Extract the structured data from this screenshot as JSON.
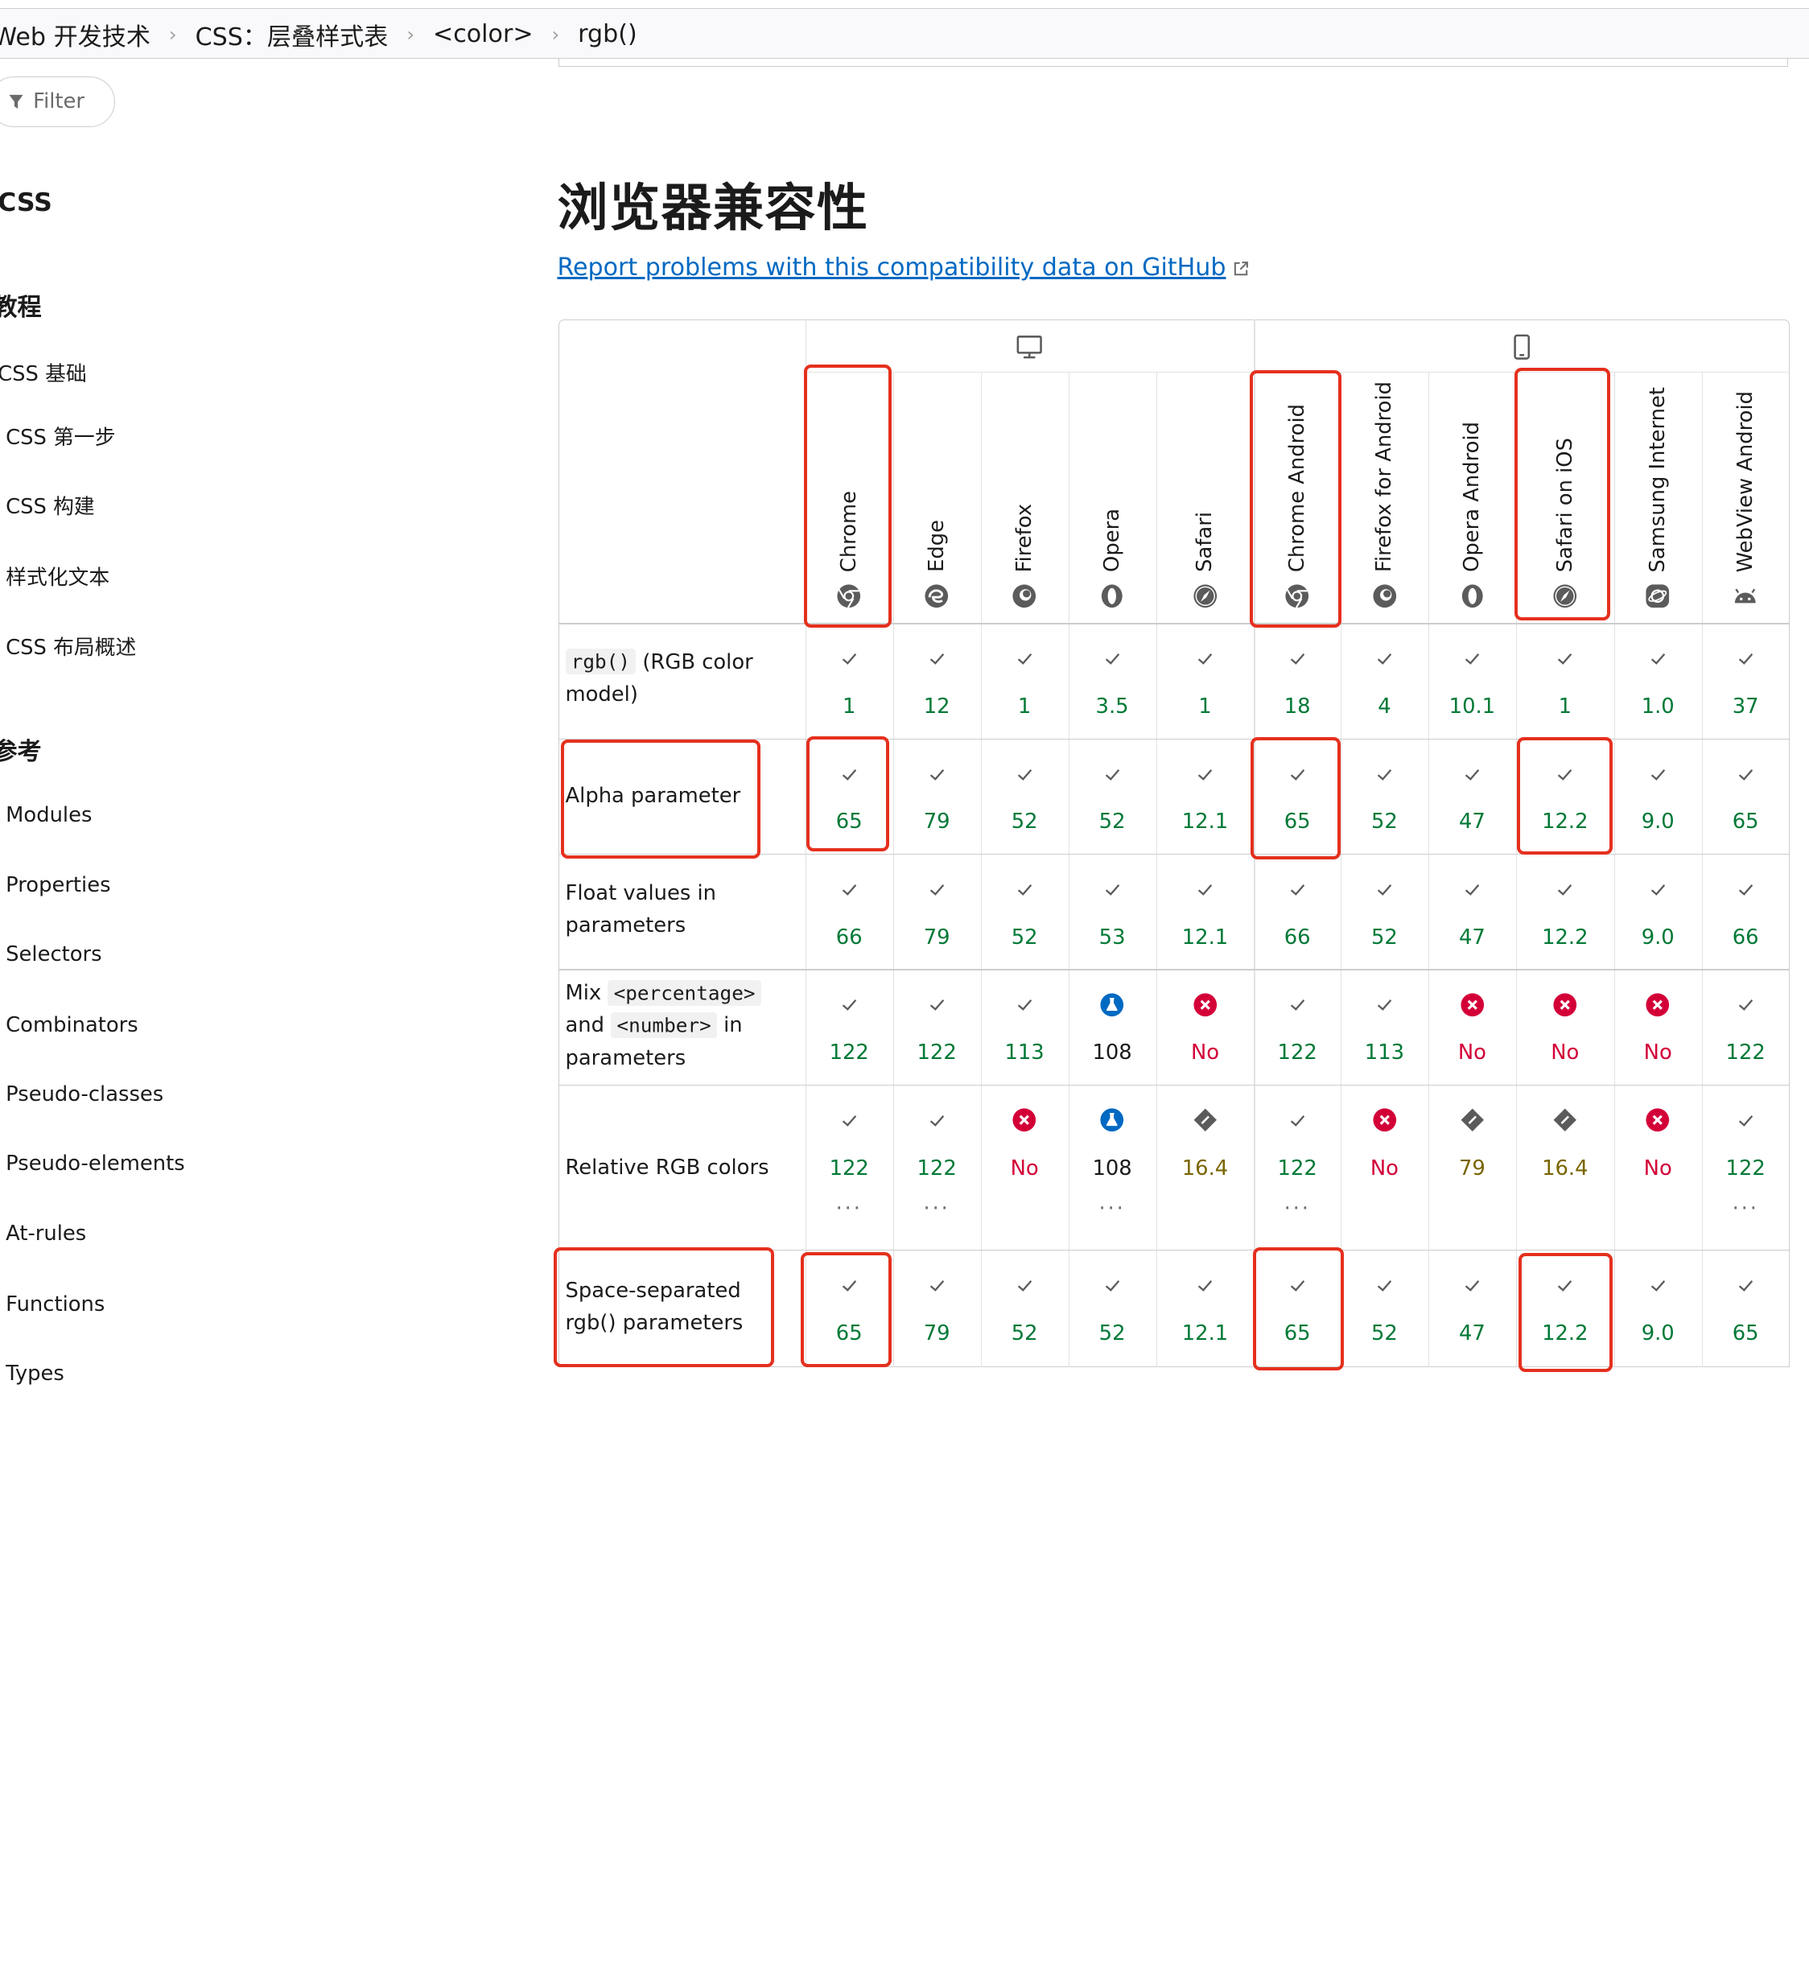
{
  "breadcrumb": [
    "Web 开发技术",
    "CSS：层叠样式表",
    "<color>",
    "rgb()"
  ],
  "sidebar": {
    "filter_placeholder": "Filter",
    "title": "CSS",
    "tutorials_heading": "教程",
    "tutorials": [
      "CSS 基础",
      "CSS 第一步",
      "CSS 构建",
      "样式化文本",
      "CSS 布局概述"
    ],
    "reference_heading": "参考",
    "reference": [
      "Modules",
      "Properties",
      "Selectors",
      "Combinators",
      "Pseudo-classes",
      "Pseudo-elements",
      "At-rules",
      "Functions",
      "Types"
    ]
  },
  "section_title": "浏览器兼容性",
  "report_link": "Report problems with this compatibility data on GitHub",
  "platforms": [
    {
      "name": "desktop",
      "icon": "desktop-icon"
    },
    {
      "name": "mobile",
      "icon": "mobile-icon"
    }
  ],
  "browsers": [
    {
      "name": "Chrome",
      "icon": "chrome-icon",
      "platform": "desktop"
    },
    {
      "name": "Edge",
      "icon": "edge-icon",
      "platform": "desktop"
    },
    {
      "name": "Firefox",
      "icon": "firefox-icon",
      "platform": "desktop"
    },
    {
      "name": "Opera",
      "icon": "opera-icon",
      "platform": "desktop"
    },
    {
      "name": "Safari",
      "icon": "safari-icon",
      "platform": "desktop"
    },
    {
      "name": "Chrome Android",
      "icon": "chrome-icon",
      "platform": "mobile"
    },
    {
      "name": "Firefox for Android",
      "icon": "firefox-icon",
      "platform": "mobile"
    },
    {
      "name": "Opera Android",
      "icon": "opera-icon",
      "platform": "mobile"
    },
    {
      "name": "Safari on iOS",
      "icon": "safari-icon",
      "platform": "mobile"
    },
    {
      "name": "Samsung Internet",
      "icon": "samsung-internet-icon",
      "platform": "mobile"
    },
    {
      "name": "WebView Android",
      "icon": "android-icon",
      "platform": "mobile"
    }
  ],
  "features": [
    {
      "code": "rgb()",
      "label": "(RGB color model)",
      "support": [
        {
          "s": "yes",
          "v": "1"
        },
        {
          "s": "yes",
          "v": "12"
        },
        {
          "s": "yes",
          "v": "1"
        },
        {
          "s": "yes",
          "v": "3.5"
        },
        {
          "s": "yes",
          "v": "1"
        },
        {
          "s": "yes",
          "v": "18"
        },
        {
          "s": "yes",
          "v": "4"
        },
        {
          "s": "yes",
          "v": "10.1"
        },
        {
          "s": "yes",
          "v": "1"
        },
        {
          "s": "yes",
          "v": "1.0"
        },
        {
          "s": "yes",
          "v": "37"
        }
      ]
    },
    {
      "label": "Alpha parameter",
      "support": [
        {
          "s": "yes",
          "v": "65"
        },
        {
          "s": "yes",
          "v": "79"
        },
        {
          "s": "yes",
          "v": "52"
        },
        {
          "s": "yes",
          "v": "52"
        },
        {
          "s": "yes",
          "v": "12.1"
        },
        {
          "s": "yes",
          "v": "65"
        },
        {
          "s": "yes",
          "v": "52"
        },
        {
          "s": "yes",
          "v": "47"
        },
        {
          "s": "yes",
          "v": "12.2"
        },
        {
          "s": "yes",
          "v": "9.0"
        },
        {
          "s": "yes",
          "v": "65"
        }
      ]
    },
    {
      "label": "Float values in parameters",
      "support": [
        {
          "s": "yes",
          "v": "66"
        },
        {
          "s": "yes",
          "v": "79"
        },
        {
          "s": "yes",
          "v": "52"
        },
        {
          "s": "yes",
          "v": "53"
        },
        {
          "s": "yes",
          "v": "12.1"
        },
        {
          "s": "yes",
          "v": "66"
        },
        {
          "s": "yes",
          "v": "52"
        },
        {
          "s": "yes",
          "v": "47"
        },
        {
          "s": "yes",
          "v": "12.2"
        },
        {
          "s": "yes",
          "v": "9.0"
        },
        {
          "s": "yes",
          "v": "66"
        }
      ]
    },
    {
      "parts": [
        "Mix",
        "<percentage>",
        "and",
        "<number>",
        "in parameters"
      ],
      "support": [
        {
          "s": "yes",
          "v": "122"
        },
        {
          "s": "yes",
          "v": "122"
        },
        {
          "s": "yes",
          "v": "113"
        },
        {
          "s": "flag",
          "v": "108"
        },
        {
          "s": "no",
          "v": "No"
        },
        {
          "s": "yes",
          "v": "122"
        },
        {
          "s": "yes",
          "v": "113"
        },
        {
          "s": "no",
          "v": "No"
        },
        {
          "s": "no",
          "v": "No"
        },
        {
          "s": "no",
          "v": "No"
        },
        {
          "s": "yes",
          "v": "122"
        }
      ]
    },
    {
      "label": "Relative RGB colors",
      "support": [
        {
          "s": "yes",
          "v": "122",
          "more": "···"
        },
        {
          "s": "yes",
          "v": "122",
          "more": "···"
        },
        {
          "s": "no",
          "v": "No"
        },
        {
          "s": "flag",
          "v": "108",
          "more": "···"
        },
        {
          "s": "partial",
          "v": "16.4"
        },
        {
          "s": "yes",
          "v": "122",
          "more": "···"
        },
        {
          "s": "no",
          "v": "No"
        },
        {
          "s": "partial",
          "v": "79"
        },
        {
          "s": "partial",
          "v": "16.4"
        },
        {
          "s": "no",
          "v": "No"
        },
        {
          "s": "yes",
          "v": "122",
          "more": "···"
        }
      ]
    },
    {
      "label": "Space-separated rgb() parameters",
      "support": [
        {
          "s": "yes",
          "v": "65"
        },
        {
          "s": "yes",
          "v": "79"
        },
        {
          "s": "yes",
          "v": "52"
        },
        {
          "s": "yes",
          "v": "52"
        },
        {
          "s": "yes",
          "v": "12.1"
        },
        {
          "s": "yes",
          "v": "65"
        },
        {
          "s": "yes",
          "v": "52"
        },
        {
          "s": "yes",
          "v": "47"
        },
        {
          "s": "yes",
          "v": "12.2"
        },
        {
          "s": "yes",
          "v": "9.0"
        },
        {
          "s": "yes",
          "v": "65"
        }
      ]
    }
  ],
  "colors": {
    "yes": "#007936",
    "no": "#d30038",
    "partial": "#7a6500",
    "link": "#0069c2",
    "highlight": "#e5301e"
  }
}
